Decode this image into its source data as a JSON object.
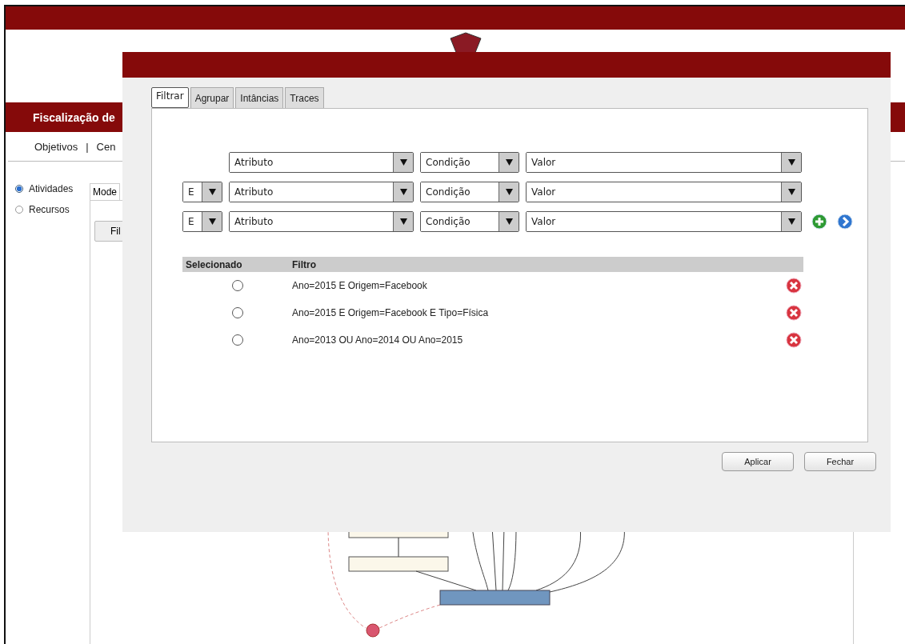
{
  "page": {
    "banner_title": "Fiscalização de",
    "nav": [
      "Objetivos",
      "|",
      "Cen"
    ],
    "view_options": [
      {
        "label": "Atividades",
        "selected": true
      },
      {
        "label": "Recursos",
        "selected": false
      }
    ],
    "panel_tab": "Mode",
    "panel_button": "Fil"
  },
  "dialog": {
    "tabs": [
      {
        "label": "Filtrar",
        "selected": true
      },
      {
        "label": "Agrupar",
        "selected": false
      },
      {
        "label": "Intâncias",
        "selected": false
      },
      {
        "label": "Traces",
        "selected": false
      }
    ],
    "filter_rows": [
      {
        "attribute": "Atributo",
        "condition": "Condição",
        "value": "Valor"
      },
      {
        "conjunction": "E",
        "attribute": "Atributo",
        "condition": "Condição",
        "value": "Valor"
      },
      {
        "conjunction": "E",
        "attribute": "Atributo",
        "condition": "Condição",
        "value": "Valor"
      }
    ],
    "saved_filters": {
      "columns": [
        "Selecionado",
        "Filtro"
      ],
      "rows": [
        {
          "selected": false,
          "filter": "Ano=2015 E Origem=Facebook"
        },
        {
          "selected": false,
          "filter": "Ano=2015 E Origem=Facebook E Tipo=Física"
        },
        {
          "selected": false,
          "filter": "Ano=2013 OU Ano=2014 OU Ano=2015"
        }
      ]
    },
    "buttons": [
      "Aplicar",
      "Fechar"
    ]
  }
}
